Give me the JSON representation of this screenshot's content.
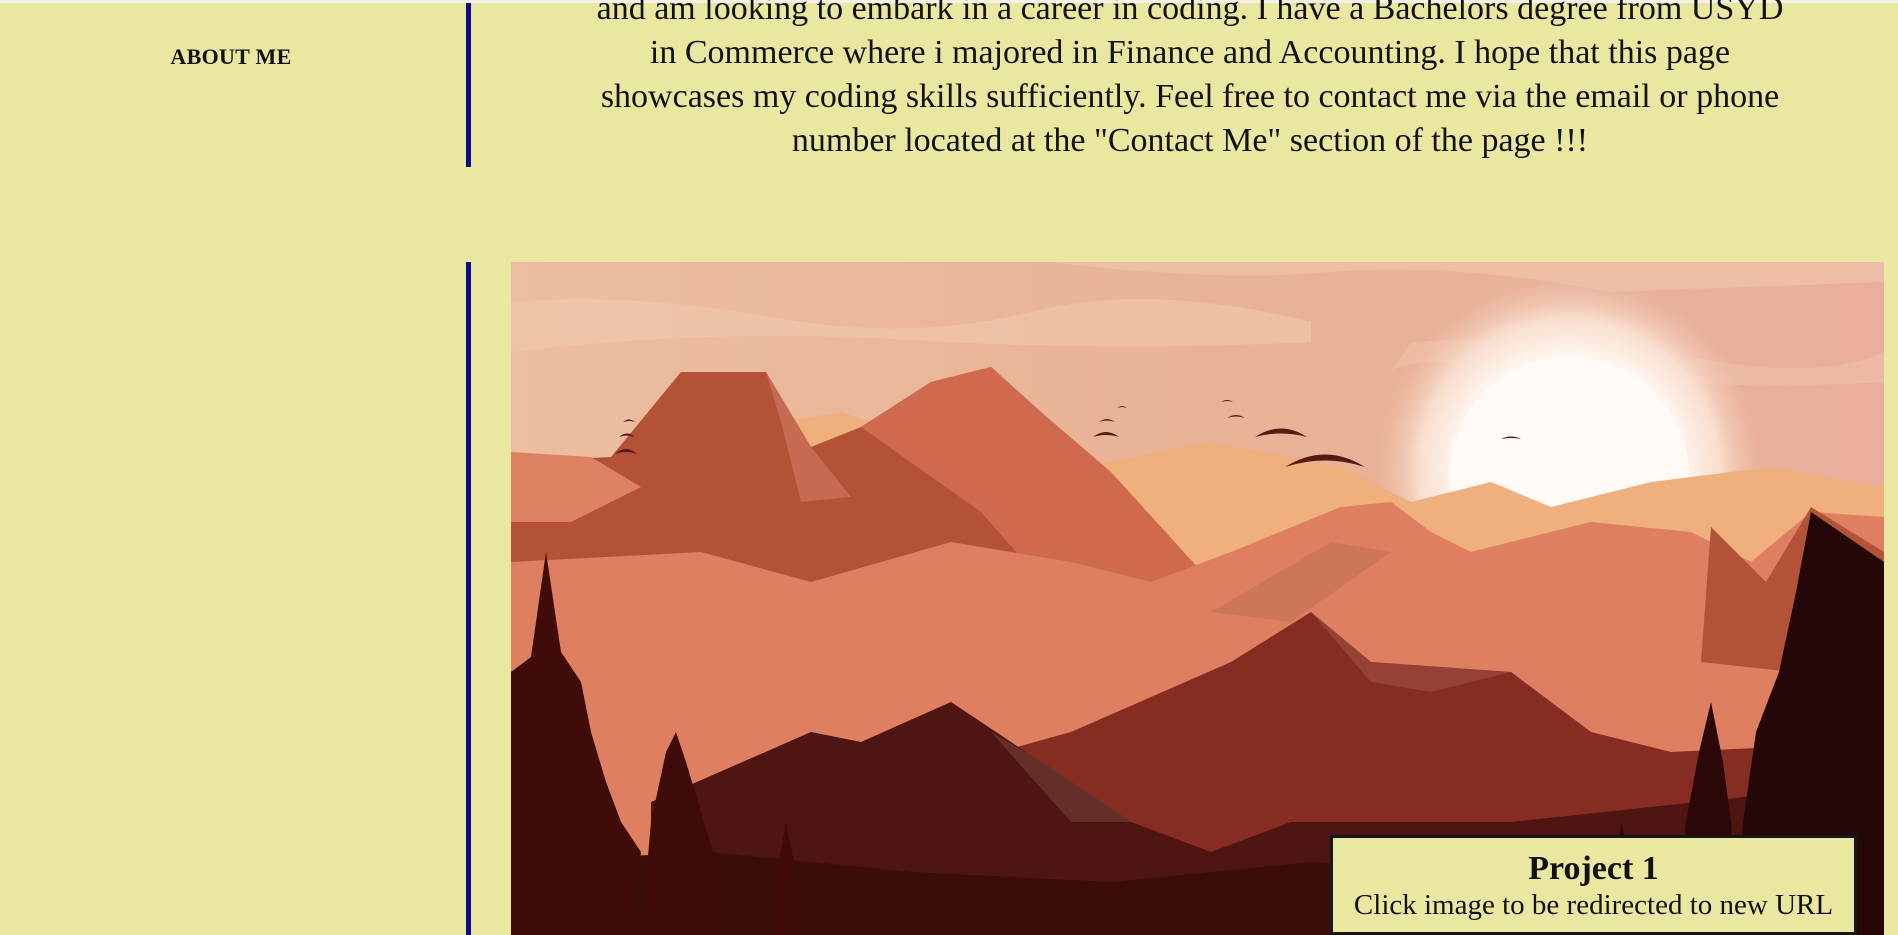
{
  "nav": {
    "about_label": "ABOUT ME"
  },
  "about": {
    "lines": [
      "and am looking to embark in a career in coding. I have a Bachelors degree from USYD",
      "in Commerce where i majored in Finance and Accounting. I hope that this page",
      "showcases my coding skills sufficiently. Feel free to contact me via the email or phone",
      "number located at the \"Contact Me\" section of the page !!!"
    ]
  },
  "project": {
    "title": "Project 1",
    "subtitle": "Click image to be redirected to new URL",
    "image_subject": "sunset mountain landscape illustration"
  },
  "colors": {
    "background": "#eae8a0",
    "divider": "#0a0a8c",
    "sky": "#e9b49a",
    "sun": "#fff7f0",
    "tree_silhouette": "#3c0c0a"
  }
}
